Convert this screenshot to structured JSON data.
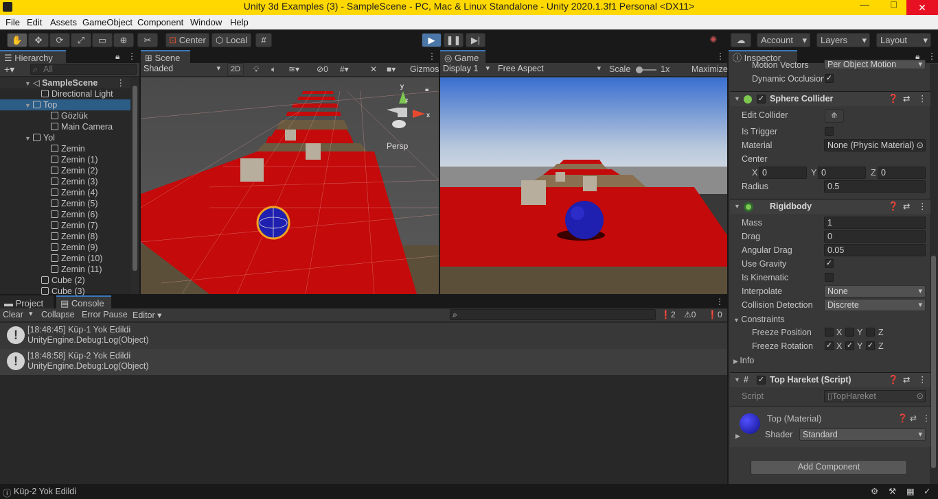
{
  "window": {
    "title": "Unity 3d Examples (3) - SampleScene - PC, Mac & Linux Standalone - Unity 2020.1.3f1 Personal <DX11>",
    "minimize": "—",
    "maximize": "□",
    "close": "✕"
  },
  "menu": [
    "File",
    "Edit",
    "Assets",
    "GameObject",
    "Component",
    "Window",
    "Help"
  ],
  "toolbar": {
    "center": "Center",
    "local": "Local",
    "account": "Account",
    "layers": "Layers",
    "layout": "Layout"
  },
  "hierarchy": {
    "tab": "Hierarchy",
    "search_placeholder": "All",
    "scene": "SampleScene",
    "items": [
      {
        "label": "Directional Light"
      },
      {
        "label": "Top"
      },
      {
        "label": "Gözlük"
      },
      {
        "label": "Main Camera"
      },
      {
        "label": "Yol"
      },
      {
        "label": "Zemin"
      },
      {
        "label": "Zemin (1)"
      },
      {
        "label": "Zemin (2)"
      },
      {
        "label": "Zemin (3)"
      },
      {
        "label": "Zemin (4)"
      },
      {
        "label": "Zemin (5)"
      },
      {
        "label": "Zemin (6)"
      },
      {
        "label": "Zemin (7)"
      },
      {
        "label": "Zemin (8)"
      },
      {
        "label": "Zemin (9)"
      },
      {
        "label": "Zemin (10)"
      },
      {
        "label": "Zemin (11)"
      },
      {
        "label": "Cube (2)"
      },
      {
        "label": "Cube (3)"
      }
    ]
  },
  "scene": {
    "tab": "Scene",
    "shading": "Shaded",
    "mode2d": "2D",
    "hidden_count": "0",
    "gizmos": "Gizmos",
    "persp": "Persp",
    "axis_x": "x",
    "axis_y": "y",
    "axis_z": "z"
  },
  "game": {
    "tab": "Game",
    "display": "Display 1",
    "aspect": "Free Aspect",
    "scale_label": "Scale",
    "scale_value": "1x",
    "maximize": "Maximize"
  },
  "console": {
    "tab_project": "Project",
    "tab_console": "Console",
    "clear": "Clear",
    "collapse": "Collapse",
    "error_pause": "Error Pause",
    "editor": "Editor",
    "count_info": "2",
    "count_warn": "0",
    "count_err": "0",
    "entries": [
      {
        "line1": "[18:48:45] Küp-1 Yok Edildi",
        "line2": "UnityEngine.Debug:Log(Object)"
      },
      {
        "line1": "[18:48:58] Küp-2 Yok Edildi",
        "line2": "UnityEngine.Debug:Log(Object)"
      }
    ]
  },
  "inspector": {
    "tab": "Inspector",
    "motion_vectors": {
      "label": "Motion Vectors",
      "value": "Per Object Motion"
    },
    "dynamic_occlusion": "Dynamic Occlusion",
    "sphere_collider": {
      "title": "Sphere Collider",
      "edit_collider": "Edit Collider",
      "is_trigger": "Is Trigger",
      "material_label": "Material",
      "material_value": "None (Physic Material)",
      "center_label": "Center",
      "x": "0",
      "y": "0",
      "z": "0",
      "radius_label": "Radius",
      "radius": "0.5"
    },
    "rigidbody": {
      "title": "Rigidbody",
      "mass_label": "Mass",
      "mass": "1",
      "drag_label": "Drag",
      "drag": "0",
      "angular_drag_label": "Angular Drag",
      "angular_drag": "0.05",
      "use_gravity": "Use Gravity",
      "is_kinematic": "Is Kinematic",
      "interpolate_label": "Interpolate",
      "interpolate": "None",
      "collision_label": "Collision Detection",
      "collision": "Discrete",
      "constraints": "Constraints",
      "freeze_position": "Freeze Position",
      "freeze_rotation": "Freeze Rotation",
      "info": "Info"
    },
    "script_comp": {
      "title": "Top Hareket (Script)",
      "script_label": "Script",
      "script_value": "TopHareket"
    },
    "material": {
      "title": "Top (Material)",
      "shader_label": "Shader",
      "shader": "Standard"
    },
    "add_component": "Add Component"
  },
  "status": {
    "message": "Küp-2 Yok Edildi"
  },
  "colors": {
    "accent": "#3a79bb",
    "play": "#4b77a8",
    "titlebar": "#ffd800",
    "ground_red": "#c40a0a",
    "sphere": "#1f1fb0"
  }
}
